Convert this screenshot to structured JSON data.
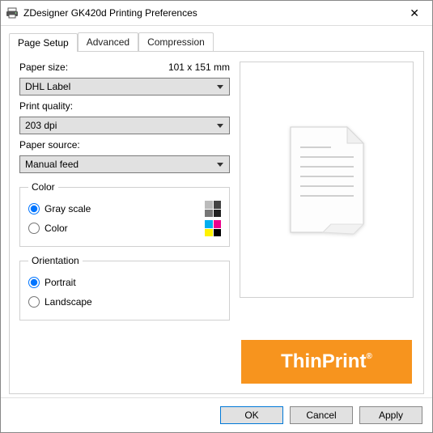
{
  "window": {
    "title": "ZDesigner GK420d Printing Preferences"
  },
  "tabs": {
    "page_setup": "Page Setup",
    "advanced": "Advanced",
    "compression": "Compression"
  },
  "page_setup": {
    "paper_size_label": "Paper size:",
    "paper_dimensions": "101 x 151 mm",
    "paper_size_value": "DHL Label",
    "print_quality_label": "Print quality:",
    "print_quality_value": "203 dpi",
    "paper_source_label": "Paper source:",
    "paper_source_value": "Manual feed",
    "color": {
      "legend": "Color",
      "gray_scale": "Gray scale",
      "color": "Color",
      "selected": "gray_scale"
    },
    "orientation": {
      "legend": "Orientation",
      "portrait": "Portrait",
      "landscape": "Landscape",
      "selected": "portrait"
    }
  },
  "logo": {
    "text": "ThinPrint"
  },
  "footer": {
    "ok": "OK",
    "cancel": "Cancel",
    "apply": "Apply"
  }
}
